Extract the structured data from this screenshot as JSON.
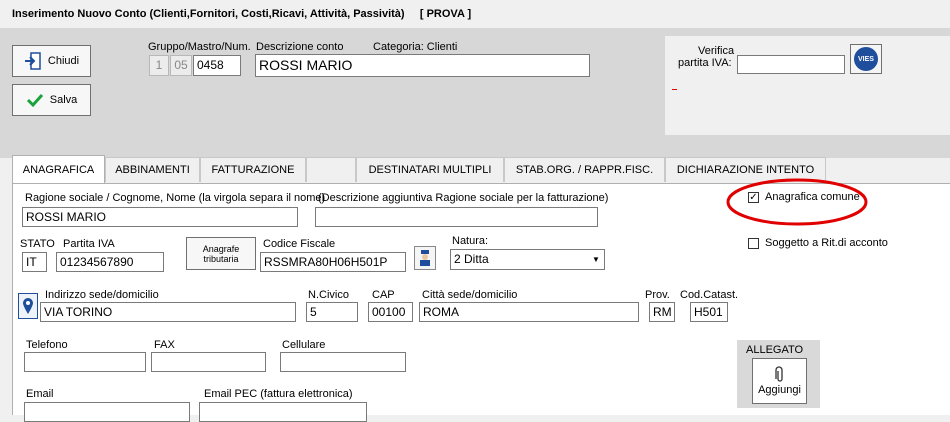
{
  "window": {
    "title": "Inserimento Nuovo Conto (Clienti,Fornitori, Costi,Ricavi, Attività, Passività)",
    "mode": "[ PROVA ]"
  },
  "toolbar": {
    "close_label": "Chiudi",
    "save_label": "Salva"
  },
  "account": {
    "code_label": "Gruppo/Mastro/Num.",
    "group": "1",
    "mastro": "05",
    "number": "0458",
    "description_label": "Descrizione conto",
    "description": "ROSSI MARIO",
    "category_label": "Categoria: Clienti"
  },
  "vat_check": {
    "label_line1": "Verifica",
    "label_line2": "partita IVA:",
    "value": "",
    "vies_label": "VIES"
  },
  "tabs": [
    "ANAGRAFICA",
    "ABBINAMENTI",
    "FATTURAZIONE",
    "DESTINATARI MULTIPLI",
    "STAB.ORG. / RAPPR.FISC.",
    "DICHIARAZIONE INTENTO"
  ],
  "form": {
    "ragione_label": "Ragione sociale / Cognome, Nome (la virgola separa il nome)",
    "ragione_value": "ROSSI MARIO",
    "descr_agg_label": "(Descrizione aggiuntiva  Ragione sociale per la fatturazione)",
    "descr_agg_value": "",
    "anagrafica_comune_label": "Anagrafica comune",
    "soggetto_rit_label": "Soggetto a Rit.di acconto",
    "stato_label": "STATO",
    "stato_value": "IT",
    "piva_label": "Partita IVA",
    "piva_value": "01234567890",
    "anagrafe_line1": "Anagrafe",
    "anagrafe_line2": "tributaria",
    "cf_label": "Codice Fiscale",
    "cf_value": "RSSMRA80H06H501P",
    "natura_label": "Natura:",
    "natura_value": "2 Ditta",
    "indirizzo_label": "Indirizzo sede/domicilio",
    "indirizzo_value": "VIA TORINO",
    "civico_label": "N.Civico",
    "civico_value": "5",
    "cap_label": "CAP",
    "cap_value": "00100",
    "citta_label": "Città sede/domicilio",
    "citta_value": "ROMA",
    "prov_label": "Prov.",
    "prov_value": "RM",
    "catast_label": "Cod.Catast.",
    "catast_value": "H501",
    "telefono_label": "Telefono",
    "fax_label": "FAX",
    "cellulare_label": "Cellulare",
    "email_label": "Email",
    "pec_label": "Email PEC (fattura elettronica)",
    "allegato_label": "ALLEGATO",
    "aggiungi_label": "Aggiungi"
  },
  "colors": {
    "annotation_red": "#e00000",
    "accent_blue": "#1f4e9c",
    "save_green": "#1aa33a"
  }
}
